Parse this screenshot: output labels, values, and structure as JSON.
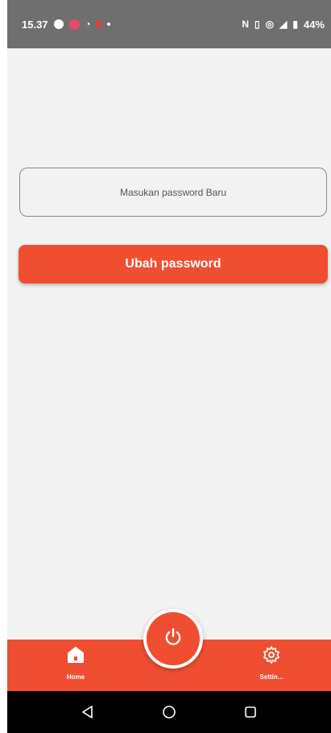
{
  "status_bar": {
    "time": "15.37",
    "battery": "44%",
    "icons": [
      "chat-icon",
      "notification-icon",
      "sync-icon",
      "nfc-icon",
      "vibrate-icon",
      "hotspot-icon",
      "signal-icon",
      "battery-icon"
    ]
  },
  "form": {
    "password_placeholder": "Masukan password Baru",
    "password_value": "",
    "submit_label": "Ubah password"
  },
  "bottom_nav": {
    "items": [
      {
        "label": "Home",
        "icon": "home-icon"
      },
      {
        "label": "Settin...",
        "icon": "gear-icon"
      }
    ],
    "fab_icon": "power-icon"
  },
  "colors": {
    "accent": "#f04e31",
    "background": "#f2f2f2",
    "status_bar": "#6f6f6f",
    "system_nav": "#000000"
  }
}
